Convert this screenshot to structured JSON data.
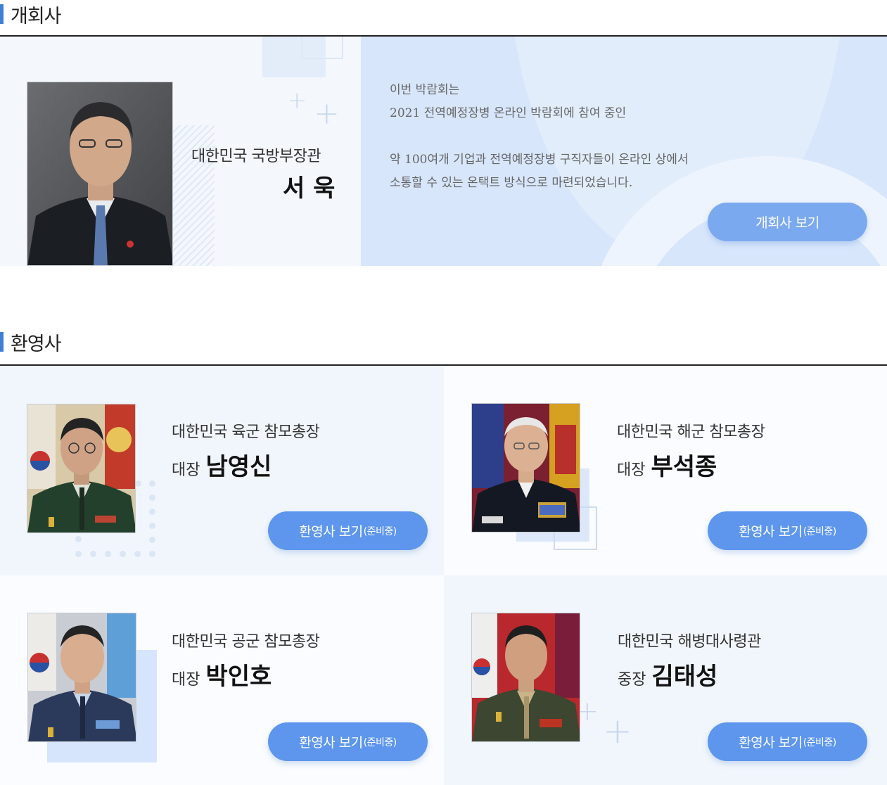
{
  "opening": {
    "section_title": "개회사",
    "official_title": "대한민국 국방부장관",
    "official_name": "서 욱",
    "desc_line1": "이번 박람회는",
    "desc_line2": "2021 전역예정장병 온라인 박람회에 참여 중인",
    "desc_line3": "약 100여개 기업과 전역예정장병 구직자들이 온라인 상에서",
    "desc_line4": "소통할 수 있는 온택트 방식으로 마련되었습니다.",
    "button_label": "개회사 보기"
  },
  "welcome": {
    "section_title": "환영사",
    "button_label": "환영사 보기",
    "button_suffix": "(준비중)",
    "cards": [
      {
        "title": "대한민국 육군 참모총장",
        "rank": "대장",
        "name": "남영신"
      },
      {
        "title": "대한민국 해군 참모총장",
        "rank": "대장",
        "name": "부석종"
      },
      {
        "title": "대한민국 공군 참모총장",
        "rank": "대장",
        "name": "박인호"
      },
      {
        "title": "대한민국 해병대사령관",
        "rank": "중장",
        "name": "김태성"
      }
    ]
  },
  "colors": {
    "accent": "#3f7fd4",
    "button": "#5d96ec",
    "panel_light": "#f4f8fd",
    "panel_blue": "#d7e6fb"
  }
}
